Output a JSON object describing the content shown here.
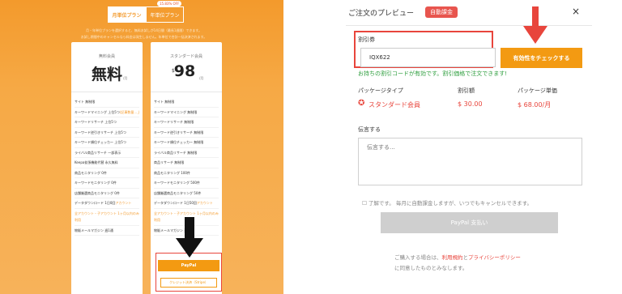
{
  "left": {
    "tab_monthly": "月単位プラン",
    "tab_yearly": "年単位プラン",
    "tab_badge": "15.83% OFF",
    "intro_line1": "月・年単位プランを選択すると、無料お試しが14日間（最長1週間）できます。",
    "intro_line2": "お試し期間中のキャンセルなら料金は発生しません。年単位で合計一括決済されます。",
    "free_card": {
      "name": "無料会員",
      "price": "無料",
      "unit": "/月",
      "features": [
        {
          "text": "サイト 無制限",
          "hl": ""
        },
        {
          "text": "キーワードマイニング 上位5つ",
          "hl": "(記事数量…上位5件)"
        },
        {
          "text": "キーワードリサーチ 上位5つ",
          "hl": ""
        },
        {
          "text": "キーワード逆引きリサーチ 上位5つ",
          "hl": ""
        },
        {
          "text": "キーワード順位チェッカー 上位5つ",
          "hl": ""
        },
        {
          "text": "ライバル商品リサーチ 一部表示",
          "hl": ""
        },
        {
          "text": "Keepa拡張機能代替 永久無料",
          "hl": ""
        },
        {
          "text": "商品モニタリング 0件",
          "hl": ""
        },
        {
          "text": "キーワードモニタリング 0件",
          "hl": ""
        },
        {
          "text": "店舗厳選商品モニタリング 0件",
          "hl": ""
        },
        {
          "text": "データダウンロード 1日0回",
          "hl": "アカウント"
        },
        {
          "text": "",
          "hl": "全アカウント・子アカウント 1ヶ月以内のみ利用"
        },
        {
          "text": "物販メールマガジン 週1通",
          "hl": ""
        }
      ]
    },
    "std_card": {
      "name": "スタンダード会員",
      "currency": "$",
      "price": "98",
      "unit": "/月",
      "features": [
        {
          "text": "サイト 無制限",
          "hl": ""
        },
        {
          "text": "キーワードマイニング 無制限",
          "hl": ""
        },
        {
          "text": "キーワードリサーチ 無制限",
          "hl": ""
        },
        {
          "text": "キーワード逆引きリサーチ 無制限",
          "hl": ""
        },
        {
          "text": "キーワード順位チェッカー 無制限",
          "hl": ""
        },
        {
          "text": "ライバル商品リサーチ 無制限",
          "hl": ""
        },
        {
          "text": "商品リサーチ 無制限",
          "hl": ""
        },
        {
          "text": "商品モニタリング 100件",
          "hl": ""
        },
        {
          "text": "キーワードモニタリング 500件",
          "hl": ""
        },
        {
          "text": "店舗厳選商品モニタリング 50件",
          "hl": ""
        },
        {
          "text": "データダウンロード 1日50回",
          "hl": "アカウント"
        },
        {
          "text": "",
          "hl": "全アカウント・子アカウント 1ヶ月以内のみ利用"
        },
        {
          "text": "物販メールマガジン 週1通",
          "hl": ""
        }
      ]
    },
    "paypal_label": "PayPal",
    "stripe_label": "クレジット決済（Stripe）"
  },
  "modal": {
    "title": "ご注文のプレビュー",
    "badge": "自動課金",
    "close": "×",
    "coupon_label": "割引券",
    "coupon_value": "IQX622",
    "check_button": "有効性をチェックする",
    "valid_message": "お持ちの割引コードが有効です。割引価格で注文できます!",
    "columns": {
      "package_type_label": "パッケージタイプ",
      "discount_label": "割引額",
      "unit_price_label": "パッケージ単価",
      "package_type_value": "スタンダード会員",
      "discount_value": "$ 30.00",
      "unit_price_value": "$ 68.00/月"
    },
    "message_label": "伝言する",
    "message_placeholder": "伝言する...",
    "agree_text": "了解です。 毎月に自動課金しますが、いつでもキャンセルできます。",
    "pay_button": "PayPal 支払い",
    "terms_prefix": "ご購入する場合は、",
    "terms_link1": "利用規約",
    "terms_and": "と",
    "terms_link2": "プライバシーポリシー",
    "terms_suffix": "に同意したものとみなします。"
  },
  "colors": {
    "orange": "#f39a12",
    "red": "#e8453c",
    "green": "#2e9e3e"
  }
}
